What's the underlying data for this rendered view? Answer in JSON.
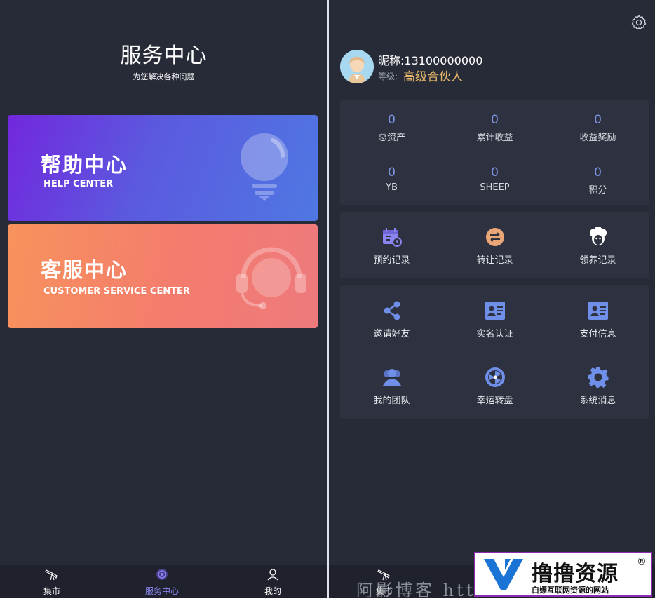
{
  "service": {
    "title": "服务中心",
    "subtitle": "为您解决各种问题",
    "help_card": {
      "title": "帮助中心",
      "subtitle": "HELP CENTER"
    },
    "cs_card": {
      "title": "客服中心",
      "subtitle": "CUSTOMER SERVICE CENTER"
    }
  },
  "tabbar": {
    "items": [
      {
        "label": "集市",
        "icon": "telescope-icon"
      },
      {
        "label": "服务中心",
        "icon": "planet-icon"
      },
      {
        "label": "我的",
        "icon": "user-icon"
      }
    ]
  },
  "profile": {
    "nickname": "昵称:13100000000",
    "level_label": "等级:",
    "level_value": "高级合伙人"
  },
  "stats": [
    {
      "value": "0",
      "label": "总资产"
    },
    {
      "value": "0",
      "label": "累计收益"
    },
    {
      "value": "0",
      "label": "收益奖励"
    },
    {
      "value": "0",
      "label": "YB"
    },
    {
      "value": "0",
      "label": "SHEEP"
    },
    {
      "value": "0",
      "label": "积分"
    }
  ],
  "records": [
    {
      "label": "预约记录",
      "icon": "calendar-clock-icon"
    },
    {
      "label": "转让记录",
      "icon": "transfer-icon"
    },
    {
      "label": "领养记录",
      "icon": "sheep-icon"
    }
  ],
  "tools": [
    {
      "label": "邀请好友",
      "icon": "share-icon"
    },
    {
      "label": "实名认证",
      "icon": "id-card-icon"
    },
    {
      "label": "支付信息",
      "icon": "payment-card-icon"
    },
    {
      "label": "我的团队",
      "icon": "team-icon"
    },
    {
      "label": "幸运转盘",
      "icon": "wheel-icon"
    },
    {
      "label": "系统消息",
      "icon": "gear-icon"
    }
  ],
  "right_tabbar": {
    "first_label": "集市"
  },
  "watermark": {
    "text": "阿影博客 htt"
  },
  "brand": {
    "name": "撸撸资源",
    "registered": "®",
    "slogan": "白嫖互联网资源的网站"
  },
  "colors": {
    "background": "#272b38",
    "panel": "#2e3240",
    "accent": "#7e95e6",
    "gold": "#e8b96a",
    "help_gradient": [
      "#7227dd",
      "#4f78e2"
    ],
    "cs_gradient": [
      "#f8925c",
      "#ee7a7d"
    ]
  }
}
